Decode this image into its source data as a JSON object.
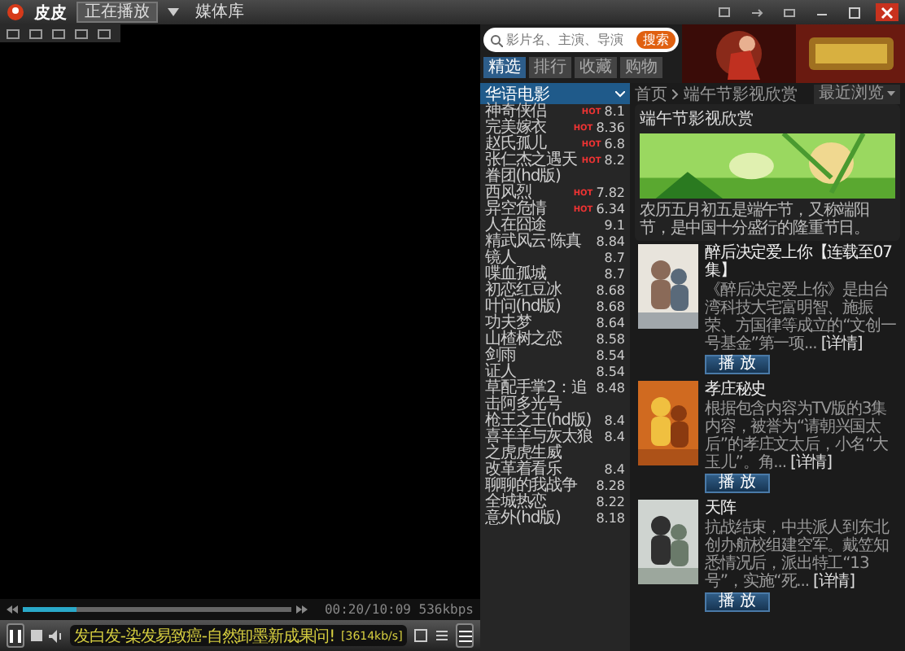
{
  "window": {
    "title": "皮皮"
  },
  "player_tabs": [
    {
      "label": "正在播放",
      "selected": true
    },
    {
      "label": "媒体库",
      "selected": false
    }
  ],
  "player": {
    "time": "00:20/10:09 536kbps",
    "level": 0.2,
    "ticker": "发白发-染发易致癌-自然卸墨新成果问!",
    "speed": "[3614kb/s]",
    "playing": true
  },
  "search": {
    "placeholder": "影片名、主演、导演",
    "button": "搜索"
  },
  "nav_tabs": [
    {
      "label": "精选",
      "selected": true
    },
    {
      "label": "排行",
      "selected": false
    },
    {
      "label": "收藏",
      "selected": false
    },
    {
      "label": "购物",
      "selected": false
    }
  ],
  "category": "华语电影",
  "movies": [
    {
      "title": "神奇侠侣",
      "badge": "HOT",
      "score": "8.1"
    },
    {
      "title": "完美嫁衣",
      "badge": "HOT",
      "score": "8.36"
    },
    {
      "title": "赵氏孤儿",
      "badge": "HOT",
      "score": "6.8"
    },
    {
      "title": "张仁杰之遇天眷团(hd版)",
      "badge": "HOT",
      "score": "8.2"
    },
    {
      "title": "西风烈",
      "badge": "HOT",
      "score": "7.82"
    },
    {
      "title": "异空危情",
      "badge": "HOT",
      "score": "6.34"
    },
    {
      "title": "人在囧途",
      "score": "9.1"
    },
    {
      "title": "精武风云·陈真",
      "score": "8.84"
    },
    {
      "title": "镜人",
      "score": "8.7"
    },
    {
      "title": "喋血孤城",
      "score": "8.7"
    },
    {
      "title": "初恋红豆冰",
      "score": "8.68"
    },
    {
      "title": "叶问(hd版)",
      "score": "8.68"
    },
    {
      "title": "功夫梦",
      "score": "8.64"
    },
    {
      "title": "山楂树之恋",
      "score": "8.58"
    },
    {
      "title": "剑雨",
      "score": "8.54"
    },
    {
      "title": "证人",
      "score": "8.54"
    },
    {
      "title": "草配手掌2：追击阿多光号",
      "score": "8.48"
    },
    {
      "title": "枪王之王(hd版)",
      "score": "8.4"
    },
    {
      "title": "喜羊羊与灰太狼之虎虎生威",
      "score": "8.4"
    },
    {
      "title": "改革着看乐",
      "score": "8.4"
    },
    {
      "title": "聊聊的我战争",
      "score": "8.28"
    },
    {
      "title": "全城热恋",
      "score": "8.22"
    },
    {
      "title": "意外(hd版)",
      "score": "8.18"
    }
  ],
  "breadcrumb": [
    "首页",
    "端午节影视欣赏"
  ],
  "recent": "最近浏览",
  "feature": {
    "title": "端午节影视欣赏",
    "intro": "农历五月初五是端午节，又称端阳节，是中国十分盛行的隆重节日。"
  },
  "items": [
    {
      "title": "醉后决定爱上你【连载至07集】",
      "desc": "《醉后决定爱上你》是由台湾科技大宅富明智、施振荣、方国律等成立的“文创一号基金”第一项...",
      "more": "[详情]",
      "button": "播 放"
    },
    {
      "title": "孝庄秘史",
      "desc": "根据包含内容为TV版的3集内容，被誉为“请朝兴国太后”的孝庄文太后，小名“大玉儿”。角...",
      "more": "[详情]",
      "button": "播 放"
    },
    {
      "title": "天阵",
      "desc": "抗战结束，中共派人到东北创办航校组建空军。戴笠知悉情况后，派出特工“13号”，实施“死...",
      "more": "[详情]",
      "button": "播 放"
    }
  ]
}
